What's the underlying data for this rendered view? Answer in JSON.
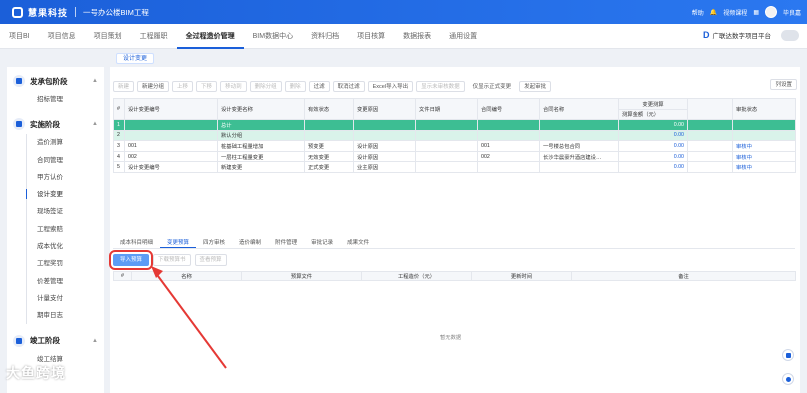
{
  "topbar": {
    "brand": "慧果科技",
    "project": "一号办公楼BIM工程",
    "help": "帮助",
    "tutorial": "视频课程",
    "user": "毕良嘉"
  },
  "nav": {
    "items": [
      "项目BI",
      "项目信息",
      "项目策划",
      "工程履职",
      "全过程造价管理",
      "BIM数据中心",
      "资料归档",
      "项目核算",
      "数据报表",
      "通用设置"
    ],
    "active": "全过程造价管理",
    "platform": "广联达数字项目平台"
  },
  "breadcrumb": "设计变更",
  "sidebar": {
    "g1": "发承包阶段",
    "g1_items": [
      "招标管理"
    ],
    "g2": "实施阶段",
    "g2_items": [
      "造价测算",
      "合同管理",
      "甲方认价",
      "设计变更",
      "现场签证",
      "工程索赔",
      "成本优化",
      "工程奖罚",
      "价差管理",
      "计量支付",
      "期审日志"
    ],
    "g3": "竣工阶段",
    "g3_items": [
      "竣工结算"
    ]
  },
  "toolbar": {
    "buttons": [
      "新建",
      "新建分组",
      "上移",
      "下移",
      "移动到",
      "删除分组",
      "删除",
      "过滤",
      "取消过滤",
      "Excel导入导出",
      "显示未审核数据",
      "仅显示正式变更",
      "发起审批"
    ],
    "column_set": "列设置"
  },
  "grid": {
    "headers": [
      "#",
      "设计变更编号",
      "设计变更名称",
      "有效状态",
      "变更原因",
      "文件日期",
      "合同编号",
      "合同名称",
      "变更测算",
      "审批状态"
    ],
    "sub_header": "测算金额（元）",
    "rows": [
      {
        "no": "1",
        "code": "",
        "name": "总计",
        "state": "",
        "reason": "",
        "contract": "",
        "cname": "",
        "amount": "0.00",
        "approval": ""
      },
      {
        "no": "2",
        "code": "",
        "name": "默认分组",
        "state": "",
        "reason": "",
        "contract": "",
        "cname": "",
        "amount": "0.00",
        "approval": ""
      },
      {
        "no": "3",
        "code": "001",
        "name": "桩基础工程量增加",
        "state": "预变更",
        "reason": "设计原因",
        "contract": "001",
        "cname": "一号楼总包合同",
        "amount": "0.00",
        "approval": "审核中"
      },
      {
        "no": "4",
        "code": "002",
        "name": "一层柱工程量变更",
        "state": "无效变更",
        "reason": "设计原因",
        "contract": "002",
        "cname": "长沙华晨豪升酒店建设…",
        "amount": "0.00",
        "approval": "审核中"
      },
      {
        "no": "5",
        "code": "设计变更编号",
        "name": "新建变更",
        "state": "正式变更",
        "reason": "业主原因",
        "contract": "",
        "cname": "",
        "amount": "0.00",
        "approval": "审核中"
      }
    ]
  },
  "lower": {
    "tabs": [
      "成本科目明细",
      "变更预算",
      "四方审核",
      "造价编制",
      "附件管理",
      "审批记录",
      "成果文件"
    ],
    "active": "变更预算",
    "buttons": [
      "导入预算",
      "下载预算书",
      "查看预算"
    ],
    "headers": [
      "#",
      "名称",
      "预算文件",
      "工程造价（元）",
      "更新时间",
      "备注"
    ],
    "empty": "暂无数据"
  },
  "watermark": "大鱼跨境"
}
